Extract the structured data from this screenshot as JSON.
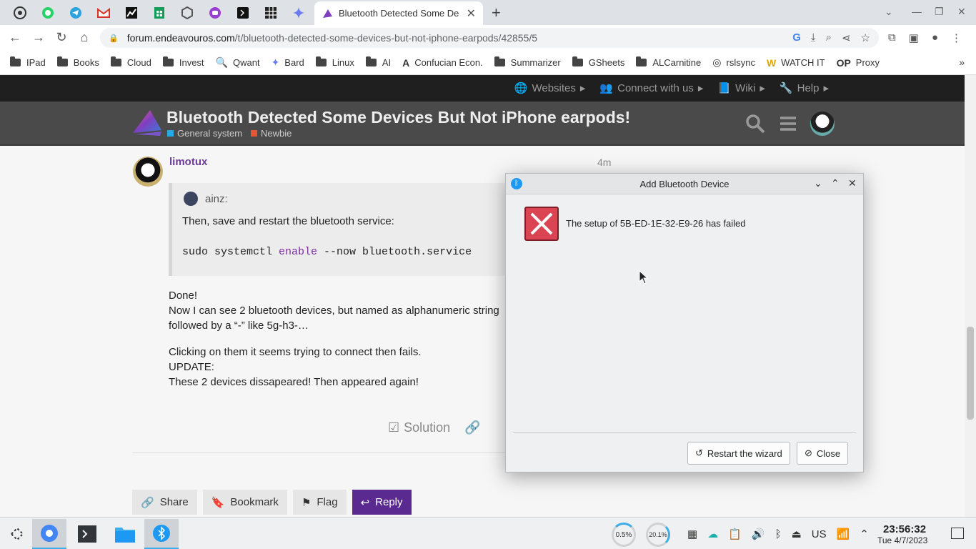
{
  "browser": {
    "pinned_tabs": [
      "chrome-icon",
      "whatsapp-icon",
      "telegram-icon",
      "gmail-icon",
      "stocks-icon",
      "sheets-icon",
      "settings-icon",
      "ai-chat-icon",
      "terminal-icon",
      "grid-icon",
      "sparkle-icon"
    ],
    "active_tab_title": "Bluetooth Detected Some De",
    "url_domain": "forum.endeavouros.com",
    "url_path": "/t/bluetooth-detected-some-devices-but-not-iphone-earpods/42855/5",
    "bookmarks": [
      {
        "label": "IPad",
        "icon": "folder"
      },
      {
        "label": "Books",
        "icon": "folder"
      },
      {
        "label": "Cloud",
        "icon": "folder"
      },
      {
        "label": "Invest",
        "icon": "folder"
      },
      {
        "label": "Qwant",
        "icon": "qwant"
      },
      {
        "label": "Bard",
        "icon": "sparkle"
      },
      {
        "label": "Linux",
        "icon": "folder"
      },
      {
        "label": "AI",
        "icon": "folder"
      },
      {
        "label": "Confucian Econ.",
        "icon": "font-a"
      },
      {
        "label": "Summarizer",
        "icon": "folder"
      },
      {
        "label": "GSheets",
        "icon": "folder"
      },
      {
        "label": "ALCarnitine",
        "icon": "folder"
      },
      {
        "label": "rslsync",
        "icon": "sync"
      },
      {
        "label": "WATCH IT",
        "icon": "w"
      },
      {
        "label": "Proxy",
        "icon": "op"
      }
    ]
  },
  "forum": {
    "topnav": [
      "Websites",
      "Connect with us",
      "Wiki",
      "Help"
    ],
    "topic_title": "Bluetooth Detected Some Devices But Not iPhone earpods!",
    "categories": [
      {
        "label": "General system",
        "color": "#25aae1"
      },
      {
        "label": "Newbie",
        "color": "#e45735"
      }
    ],
    "post": {
      "username": "limotux",
      "time": "4m",
      "quote_author": "ainz:",
      "quote_text": "Then, save and restart the bluetooth service:",
      "code_pre": "sudo systemctl ",
      "code_kw": "enable",
      "code_post": " --now bluetooth.service",
      "body": [
        "Done!",
        "Now I can see 2 bluetooth devices, but named as alphanumeric string",
        "followed by a “-” like 5g-h3-…",
        "Clicking on them it seems trying to connect then fails.",
        "UPDATE:",
        "These 2 devices dissapeared! Then appeared again!"
      ],
      "solution_label": "Solution"
    },
    "buttons": {
      "share": "Share",
      "bookmark": "Bookmark",
      "flag": "Flag",
      "reply": "Reply"
    }
  },
  "dialog": {
    "title": "Add Bluetooth Device",
    "message": "The setup of 5B-ED-1E-32-E9-26 has failed",
    "restart_label": "Restart the wizard",
    "close_label": "Close"
  },
  "taskbar": {
    "cpu": "0.5%",
    "mem": "20.1%",
    "keyboard_layout": "US",
    "time": "23:56:32",
    "date": "Tue 4/7/2023"
  },
  "colors": {
    "accent_purple": "#5b2a91",
    "error_red": "#da4453",
    "kde_blue": "#3daee9"
  }
}
